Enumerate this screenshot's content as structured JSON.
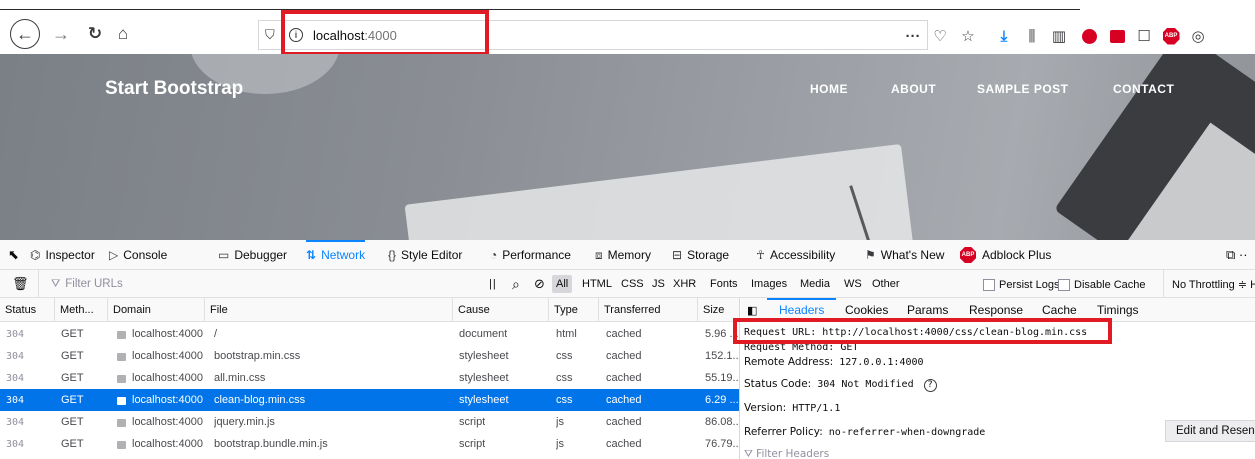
{
  "browser": {
    "url_host": "localhost",
    "url_port": ":4000",
    "icons": [
      "back-icon",
      "forward-icon",
      "reload-icon",
      "home-icon",
      "shield-icon",
      "info-icon",
      "more-icon",
      "pocket-icon",
      "bookmark-star-icon",
      "download-icon",
      "library-icon",
      "sidebar-icon",
      "adblock-icon"
    ]
  },
  "page": {
    "brand": "Start Bootstrap",
    "nav": {
      "home": "HOME",
      "about": "ABOUT",
      "sample_post": "SAMPLE POST",
      "contact": "CONTACT"
    }
  },
  "devtools": {
    "tabs": {
      "inspector": "Inspector",
      "console": "Console",
      "debugger": "Debugger",
      "network": "Network",
      "style_editor": "Style Editor",
      "performance": "Performance",
      "memory": "Memory",
      "storage": "Storage",
      "accessibility": "Accessibility",
      "whats_new": "What's New",
      "adblock": "Adblock Plus"
    },
    "active_tab": "Network",
    "accent_color": "#0a84ff"
  },
  "network": {
    "filter_placeholder": "Filter URLs",
    "filters": {
      "all": "All",
      "html": "HTML",
      "css": "CSS",
      "js": "JS",
      "xhr": "XHR",
      "fonts": "Fonts",
      "images": "Images",
      "media": "Media",
      "ws": "WS",
      "other": "Other"
    },
    "persist_logs": "Persist Logs",
    "disable_cache": "Disable Cache",
    "throttling": "No Throttling ≑ H.",
    "columns": {
      "status": "Status",
      "method": "Meth...",
      "domain": "Domain",
      "file": "File",
      "cause": "Cause",
      "type": "Type",
      "transferred": "Transferred",
      "size": "Size"
    },
    "rows": [
      {
        "status": "304",
        "method": "GET",
        "domain": "localhost:4000",
        "file": "/",
        "cause": "document",
        "type": "html",
        "transferred": "cached",
        "size": "5.96 ..."
      },
      {
        "status": "304",
        "method": "GET",
        "domain": "localhost:4000",
        "file": "bootstrap.min.css",
        "cause": "stylesheet",
        "type": "css",
        "transferred": "cached",
        "size": "152.1..."
      },
      {
        "status": "304",
        "method": "GET",
        "domain": "localhost:4000",
        "file": "all.min.css",
        "cause": "stylesheet",
        "type": "css",
        "transferred": "cached",
        "size": "55.19..."
      },
      {
        "status": "304",
        "method": "GET",
        "domain": "localhost:4000",
        "file": "clean-blog.min.css",
        "cause": "stylesheet",
        "type": "css",
        "transferred": "cached",
        "size": "6.29 ..."
      },
      {
        "status": "304",
        "method": "GET",
        "domain": "localhost:4000",
        "file": "jquery.min.js",
        "cause": "script",
        "type": "js",
        "transferred": "cached",
        "size": "86.08..."
      },
      {
        "status": "304",
        "method": "GET",
        "domain": "localhost:4000",
        "file": "bootstrap.bundle.min.js",
        "cause": "script",
        "type": "js",
        "transferred": "cached",
        "size": "76.79..."
      }
    ],
    "selected_row": "clean-blog.min.css"
  },
  "headers_panel": {
    "tabs": {
      "headers": "Headers",
      "cookies": "Cookies",
      "params": "Params",
      "response": "Response",
      "cache": "Cache",
      "timings": "Timings"
    },
    "request_url_label": "Request URL:",
    "request_url": "http://localhost:4000/css/clean-blog.min.css",
    "request_method_label": "Request Method:",
    "request_method": "GET",
    "remote_address_label": "Remote Address:",
    "remote_address": "127.0.0.1:4000",
    "status_code_label": "Status Code:",
    "status_code": "304",
    "status_text": "Not Modified",
    "version_label": "Version:",
    "version": "HTTP/1.1",
    "referrer_label": "Referrer Policy:",
    "referrer": "no-referrer-when-downgrade",
    "filter_placeholder": "Filter Headers",
    "edit_resend": "Edit and Resen"
  },
  "highlight_color": "#e01b24"
}
